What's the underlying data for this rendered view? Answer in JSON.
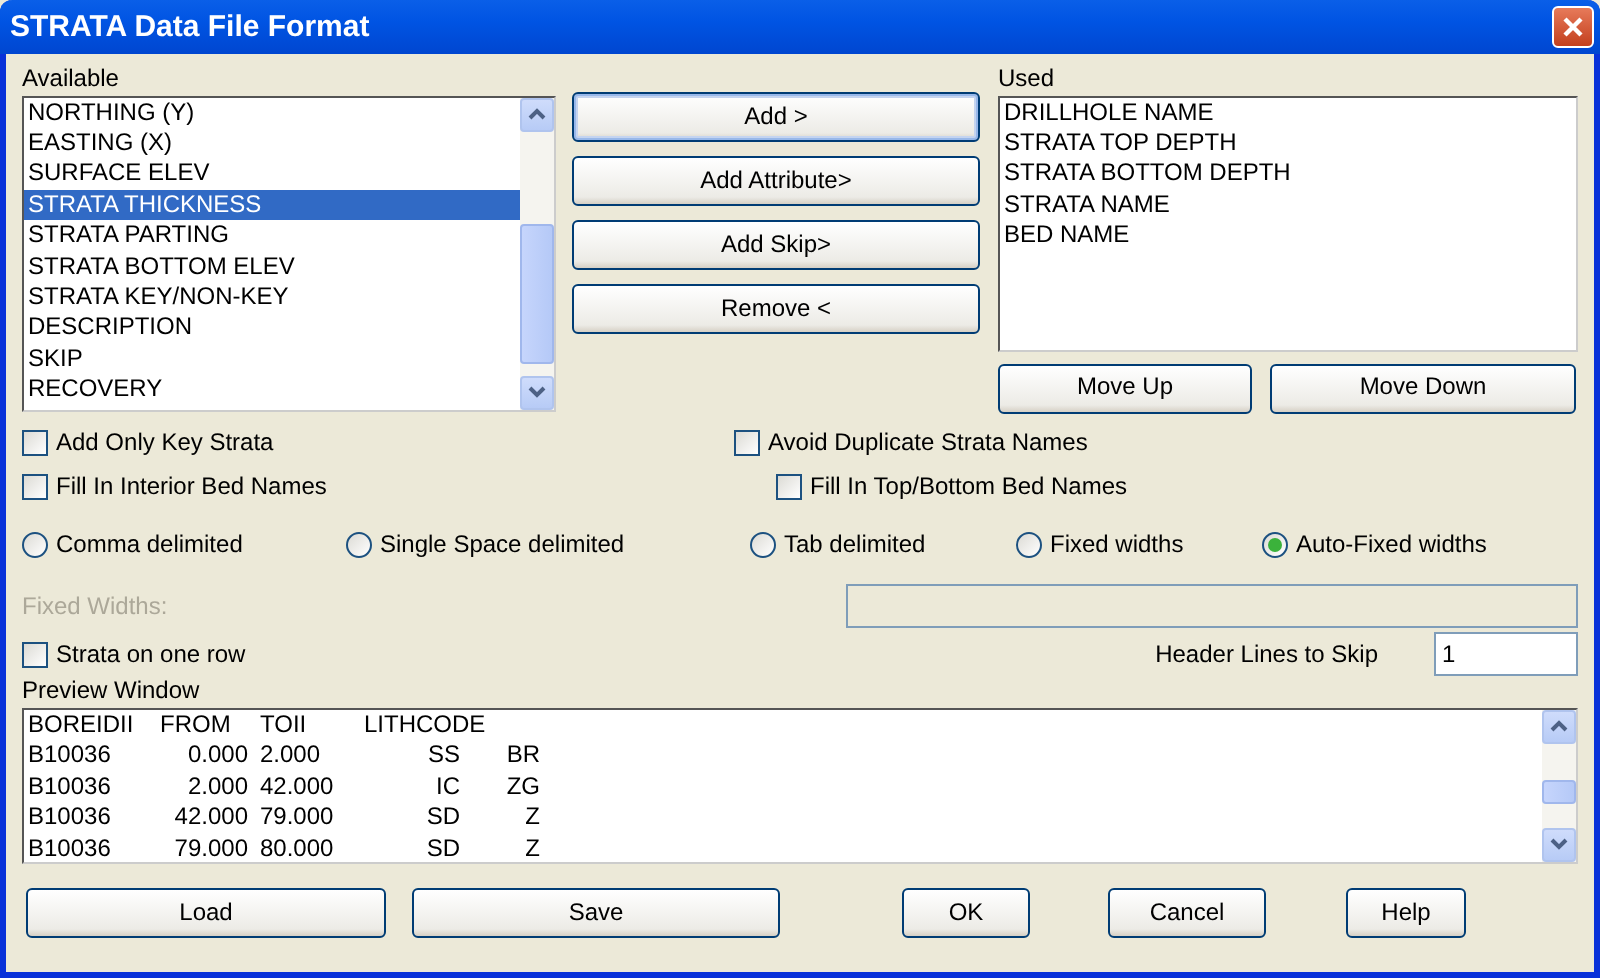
{
  "window": {
    "title": "STRATA Data File Format"
  },
  "available": {
    "label": "Available",
    "items": [
      {
        "text": "NORTHING (Y)",
        "selected": false
      },
      {
        "text": "EASTING (X)",
        "selected": false
      },
      {
        "text": "SURFACE ELEV",
        "selected": false
      },
      {
        "text": "STRATA THICKNESS",
        "selected": true
      },
      {
        "text": "STRATA PARTING",
        "selected": false
      },
      {
        "text": "STRATA BOTTOM ELEV",
        "selected": false
      },
      {
        "text": "STRATA KEY/NON-KEY",
        "selected": false
      },
      {
        "text": "DESCRIPTION",
        "selected": false
      },
      {
        "text": "SKIP",
        "selected": false
      },
      {
        "text": "RECOVERY",
        "selected": false
      }
    ]
  },
  "action_buttons": [
    {
      "label": "Add >",
      "focused": true
    },
    {
      "label": "Add Attribute>",
      "focused": false
    },
    {
      "label": "Add Skip>",
      "focused": false
    },
    {
      "label": "Remove <",
      "focused": false
    }
  ],
  "used": {
    "label": "Used",
    "items": [
      {
        "text": "DRILLHOLE NAME",
        "selected": false
      },
      {
        "text": "STRATA TOP DEPTH",
        "selected": false
      },
      {
        "text": "STRATA BOTTOM DEPTH",
        "selected": false
      },
      {
        "text": "STRATA NAME",
        "selected": false
      },
      {
        "text": "BED NAME",
        "selected": false
      }
    ]
  },
  "move_buttons": [
    "Move Up",
    "Move Down"
  ],
  "options": [
    {
      "label": "Add Only Key Strata",
      "checked": false
    },
    {
      "label": "Avoid Duplicate Strata Names",
      "checked": false
    },
    {
      "label": "Fill In Interior Bed Names",
      "checked": false
    },
    {
      "label": "Fill In Top/Bottom Bed Names",
      "checked": false
    }
  ],
  "delimiters": [
    {
      "label": "Comma delimited",
      "selected": false
    },
    {
      "label": "Single Space delimited",
      "selected": false
    },
    {
      "label": "Tab delimited",
      "selected": false
    },
    {
      "label": "Fixed widths",
      "selected": false
    },
    {
      "label": "Auto-Fixed widths",
      "selected": true
    }
  ],
  "fixed_widths": {
    "label": "Fixed Widths:",
    "disabled": true
  },
  "strata_on_one_row": {
    "label": "Strata on one row",
    "checked": false
  },
  "header_lines": {
    "label": "Header Lines to Skip",
    "value": "1"
  },
  "preview": {
    "label": "Preview Window",
    "header": [
      "BOREIDII",
      "FROM",
      "TOII",
      "LITHCODE"
    ],
    "rows": [
      [
        "B10036",
        "0.000",
        "2.000",
        "SS",
        "BR"
      ],
      [
        "B10036",
        "2.000",
        "42.000",
        "IC",
        "ZG"
      ],
      [
        "B10036",
        "42.000",
        "79.000",
        "SD",
        "Z"
      ],
      [
        "B10036",
        "79.000",
        "80.000",
        "SD",
        "Z"
      ]
    ]
  },
  "dialog_buttons": [
    "Load",
    "Save",
    "OK",
    "Cancel",
    "Help"
  ]
}
